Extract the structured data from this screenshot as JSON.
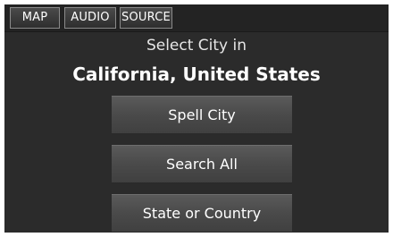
{
  "tabs": {
    "map": "MAP",
    "audio": "AUDIO",
    "source": "SOURCE"
  },
  "header": {
    "subtitle": "Select City in",
    "title": "California, United States"
  },
  "buttons": {
    "spell_city": "Spell City",
    "search_all": "Search All",
    "state_or_country": "State or Country"
  }
}
